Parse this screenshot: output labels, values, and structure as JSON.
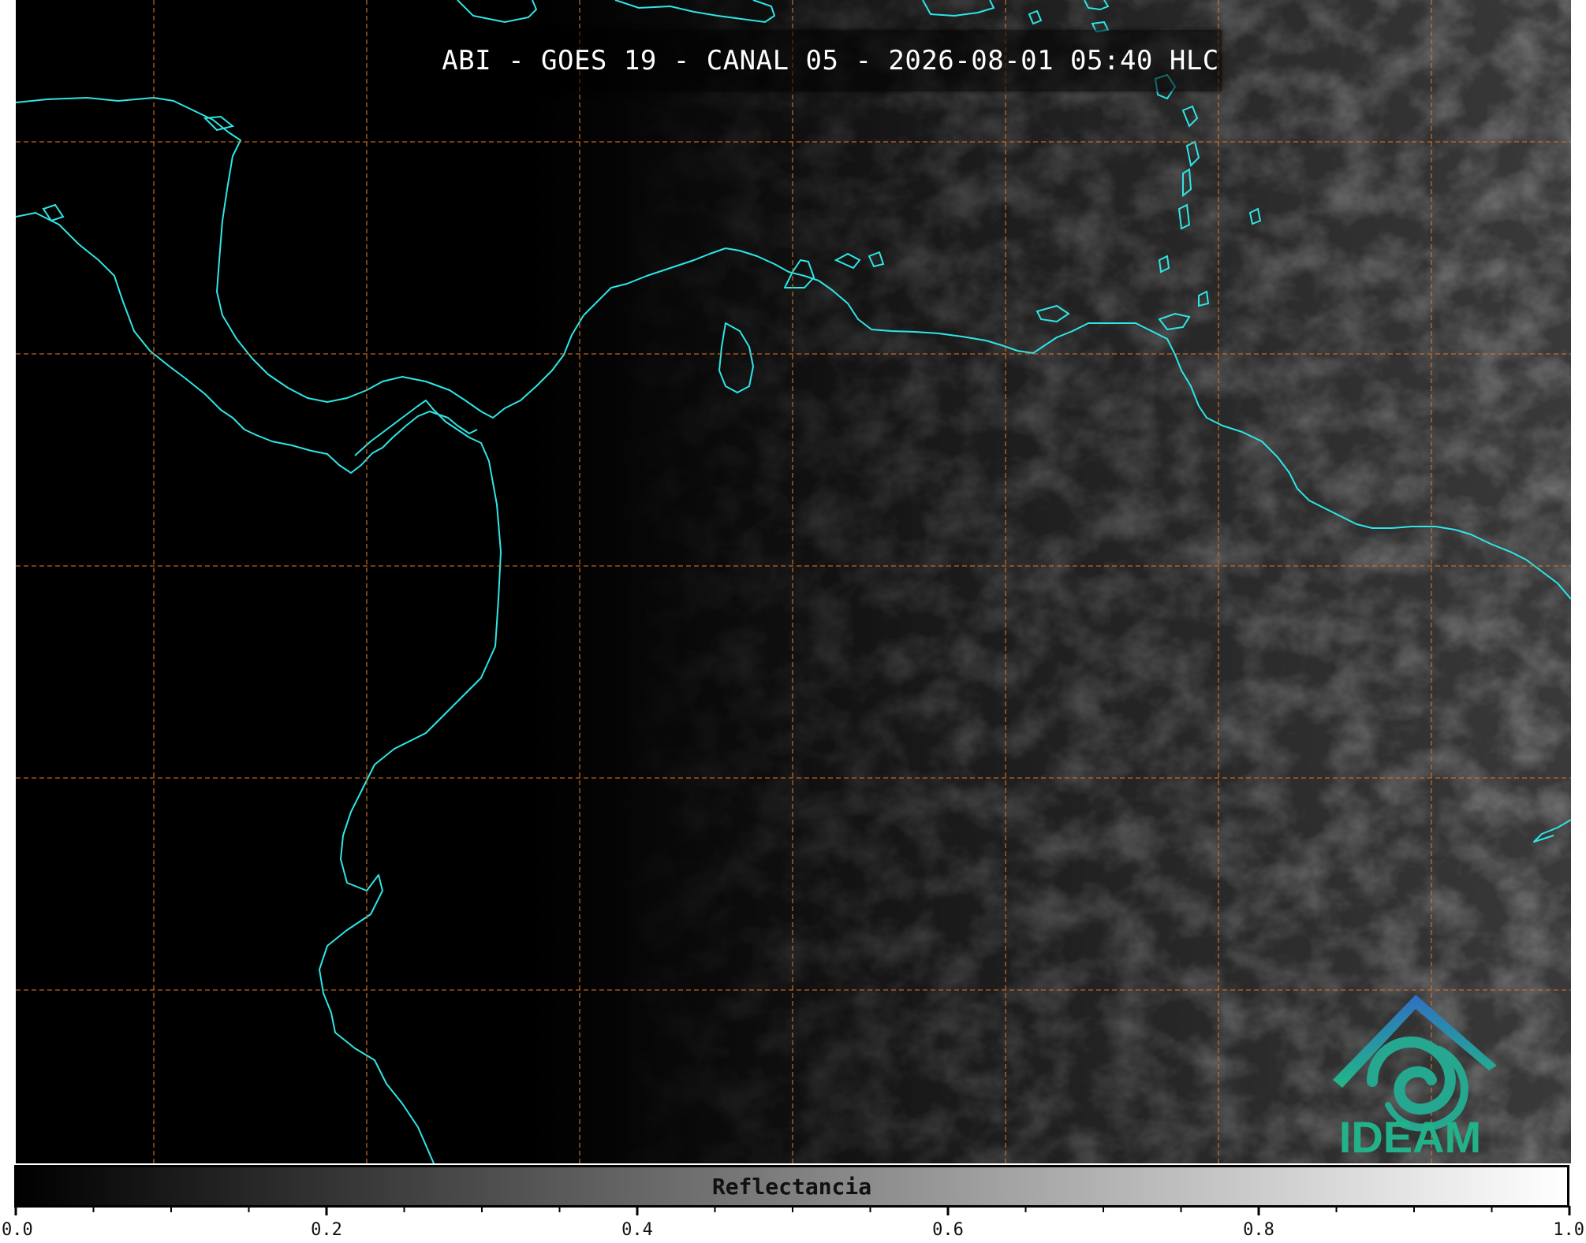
{
  "title": "ABI - GOES 19 - CANAL 05 - 2026-08-01 05:40 HLC",
  "logo": {
    "text": "IDEAM",
    "icon": "ideam-logo-icon"
  },
  "colorbar": {
    "label": "Reflectancia",
    "min": 0.0,
    "max": 1.0,
    "tick_labels": [
      "0.0",
      "0.2",
      "0.4",
      "0.6",
      "0.8",
      "1.0"
    ],
    "minor_step": 0.05,
    "gradient_from": "#000000",
    "gradient_to": "#ffffff"
  },
  "colors": {
    "coastline": "#2ee6e6",
    "gridlines": "#d8742c",
    "background": "#000000",
    "logo_blue": "#2f7fc1",
    "logo_green": "#22b28a"
  }
}
